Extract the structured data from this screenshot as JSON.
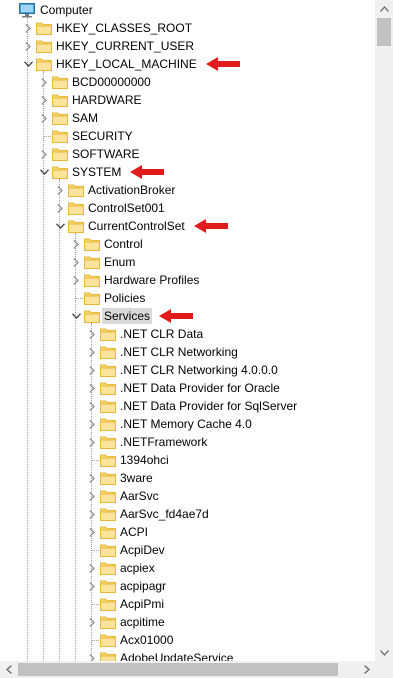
{
  "tree": [
    {
      "label": "Computer",
      "level": 0,
      "icon": "computer-icon",
      "state": "expanded-root"
    },
    {
      "label": "HKEY_CLASSES_ROOT",
      "level": 1,
      "state": "collapsed"
    },
    {
      "label": "HKEY_CURRENT_USER",
      "level": 1,
      "state": "collapsed"
    },
    {
      "label": "HKEY_LOCAL_MACHINE",
      "level": 1,
      "state": "expanded",
      "annotated": true
    },
    {
      "label": "BCD00000000",
      "level": 2,
      "state": "collapsed"
    },
    {
      "label": "HARDWARE",
      "level": 2,
      "state": "collapsed"
    },
    {
      "label": "SAM",
      "level": 2,
      "state": "collapsed"
    },
    {
      "label": "SECURITY",
      "level": 2,
      "state": "leaf"
    },
    {
      "label": "SOFTWARE",
      "level": 2,
      "state": "collapsed"
    },
    {
      "label": "SYSTEM",
      "level": 2,
      "state": "expanded",
      "annotated": true
    },
    {
      "label": "ActivationBroker",
      "level": 3,
      "state": "collapsed"
    },
    {
      "label": "ControlSet001",
      "level": 3,
      "state": "collapsed"
    },
    {
      "label": "CurrentControlSet",
      "level": 3,
      "state": "expanded",
      "annotated": true
    },
    {
      "label": "Control",
      "level": 4,
      "state": "collapsed"
    },
    {
      "label": "Enum",
      "level": 4,
      "state": "collapsed"
    },
    {
      "label": "Hardware Profiles",
      "level": 4,
      "state": "collapsed"
    },
    {
      "label": "Policies",
      "level": 4,
      "state": "leaf"
    },
    {
      "label": "Services",
      "level": 4,
      "state": "expanded",
      "annotated": true,
      "selected": true
    },
    {
      "label": ".NET CLR Data",
      "level": 5,
      "state": "collapsed"
    },
    {
      "label": ".NET CLR Networking",
      "level": 5,
      "state": "collapsed"
    },
    {
      "label": ".NET CLR Networking 4.0.0.0",
      "level": 5,
      "state": "collapsed"
    },
    {
      "label": ".NET Data Provider for Oracle",
      "level": 5,
      "state": "collapsed"
    },
    {
      "label": ".NET Data Provider for SqlServer",
      "level": 5,
      "state": "collapsed"
    },
    {
      "label": ".NET Memory Cache 4.0",
      "level": 5,
      "state": "collapsed"
    },
    {
      "label": ".NETFramework",
      "level": 5,
      "state": "collapsed"
    },
    {
      "label": "1394ohci",
      "level": 5,
      "state": "leaf"
    },
    {
      "label": "3ware",
      "level": 5,
      "state": "collapsed"
    },
    {
      "label": "AarSvc",
      "level": 5,
      "state": "collapsed"
    },
    {
      "label": "AarSvc_fd4ae7d",
      "level": 5,
      "state": "collapsed"
    },
    {
      "label": "ACPI",
      "level": 5,
      "state": "collapsed"
    },
    {
      "label": "AcpiDev",
      "level": 5,
      "state": "leaf"
    },
    {
      "label": "acpiex",
      "level": 5,
      "state": "collapsed"
    },
    {
      "label": "acpipagr",
      "level": 5,
      "state": "collapsed"
    },
    {
      "label": "AcpiPmi",
      "level": 5,
      "state": "leaf"
    },
    {
      "label": "acpitime",
      "level": 5,
      "state": "collapsed"
    },
    {
      "label": "Acx01000",
      "level": 5,
      "state": "leaf"
    },
    {
      "label": "AdobeUpdateService",
      "level": 5,
      "state": "collapsed"
    }
  ],
  "colors": {
    "folder_fill": "#f8d775",
    "folder_tab": "#e8b93a",
    "annotation_arrow": "#e01b1b",
    "selection": "#d9d9d9"
  }
}
